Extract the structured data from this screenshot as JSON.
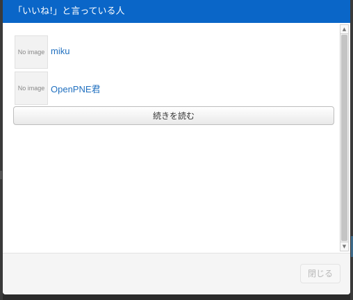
{
  "modal": {
    "title": "「いいね!」と言っている人",
    "members": [
      {
        "thumb_text": "No image",
        "name": "miku"
      },
      {
        "thumb_text": "No image",
        "name": "OpenPNE君"
      }
    ],
    "more_label": "続きを読む",
    "close_label": "閉じる"
  },
  "scrollbar": {
    "up_icon": "▲",
    "down_icon": "▼"
  }
}
